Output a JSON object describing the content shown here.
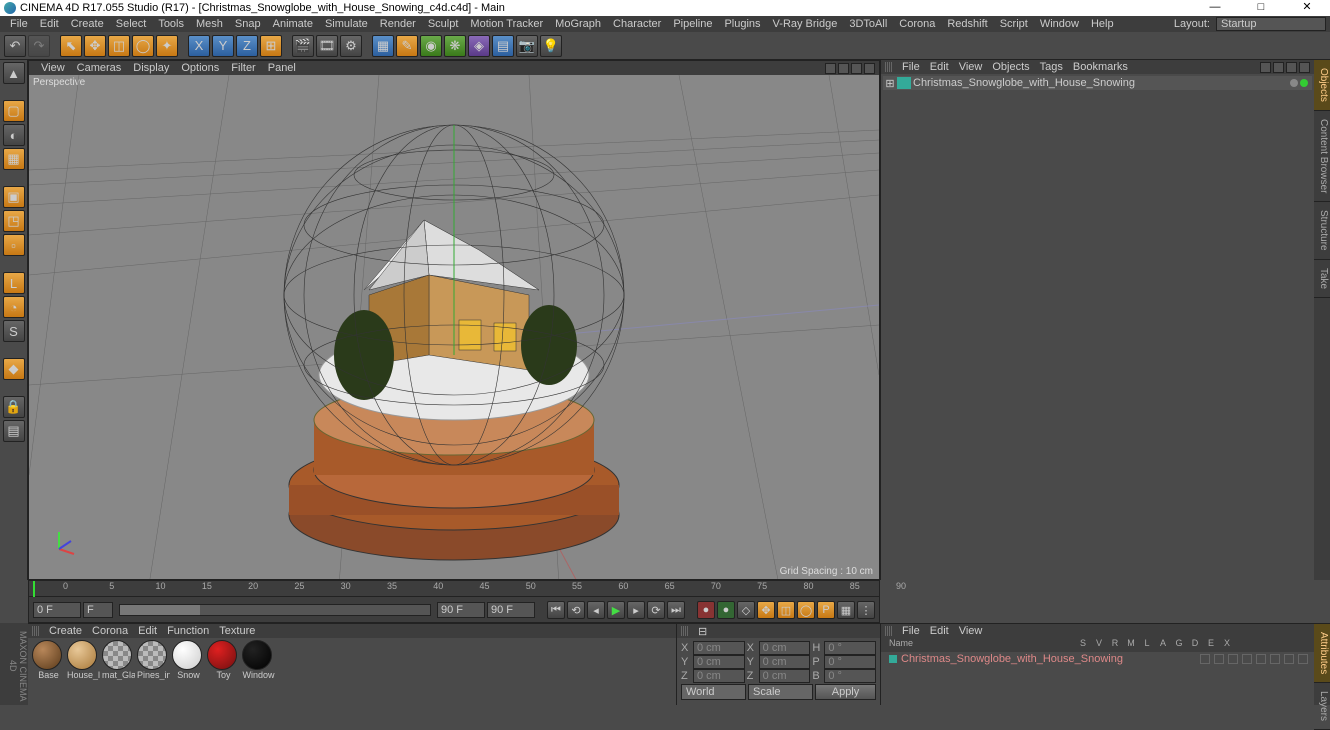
{
  "title": "CINEMA 4D R17.055 Studio (R17) - [Christmas_Snowglobe_with_House_Snowing_c4d.c4d] - Main",
  "menu": [
    "File",
    "Edit",
    "Create",
    "Select",
    "Tools",
    "Mesh",
    "Snap",
    "Animate",
    "Simulate",
    "Render",
    "Sculpt",
    "Motion Tracker",
    "MoGraph",
    "Character",
    "Pipeline",
    "Plugins",
    "V-Ray Bridge",
    "3DToAll",
    "Corona",
    "Redshift",
    "Script",
    "Window",
    "Help"
  ],
  "layout_label": "Layout:",
  "layout_value": "Startup",
  "vp_menu": [
    "View",
    "Cameras",
    "Display",
    "Options",
    "Filter",
    "Panel"
  ],
  "vp_label": "Perspective",
  "grid_info": "Grid Spacing : 10 cm",
  "obj_menu": [
    "File",
    "Edit",
    "View",
    "Objects",
    "Tags",
    "Bookmarks"
  ],
  "obj_item": "Christmas_Snowglobe_with_House_Snowing",
  "timeline": {
    "start": "0 F",
    "end": "90 F",
    "cur": "0 F",
    "fps": "F",
    "ticks": [
      "0",
      "5",
      "10",
      "15",
      "20",
      "25",
      "30",
      "35",
      "40",
      "45",
      "50",
      "55",
      "60",
      "65",
      "70",
      "75",
      "80",
      "85",
      "90"
    ]
  },
  "mat_menu": [
    "Create",
    "Corona",
    "Edit",
    "Function",
    "Texture"
  ],
  "materials": [
    {
      "name": "Base",
      "c1": "#b8875a",
      "c2": "#5a3a1a"
    },
    {
      "name": "House_l",
      "c1": "#e8c898",
      "c2": "#a87838"
    },
    {
      "name": "mat_Gla",
      "c1": "#ccc",
      "c2": "#888",
      "checker": true
    },
    {
      "name": "Pines_in",
      "c1": "#ccc",
      "c2": "#888",
      "checker": true
    },
    {
      "name": "Snow",
      "c1": "#fff",
      "c2": "#ccc"
    },
    {
      "name": "Toy",
      "c1": "#e02020",
      "c2": "#701010"
    },
    {
      "name": "Window",
      "c1": "#222",
      "c2": "#000"
    }
  ],
  "coords": {
    "rows": [
      {
        "a": "X",
        "av": "0 cm",
        "b": "X",
        "bv": "0 cm",
        "c": "H",
        "cv": "0 °"
      },
      {
        "a": "Y",
        "av": "0 cm",
        "b": "Y",
        "bv": "0 cm",
        "c": "P",
        "cv": "0 °"
      },
      {
        "a": "Z",
        "av": "0 cm",
        "b": "Z",
        "bv": "0 cm",
        "c": "B",
        "cv": "0 °"
      }
    ],
    "sel1": "World",
    "sel2": "Scale",
    "apply": "Apply"
  },
  "attr_menu": [
    "File",
    "Edit",
    "View"
  ],
  "attr_cols": [
    "S",
    "V",
    "R",
    "M",
    "L",
    "A",
    "G",
    "D",
    "E",
    "X"
  ],
  "attr_name_hdr": "Name",
  "attr_item": "Christmas_Snowglobe_with_House_Snowing",
  "sidetabs1": [
    "Objects",
    "Content Browser",
    "Structure",
    "Take"
  ],
  "sidetabs2": [
    "Attributes",
    "Layers"
  ]
}
